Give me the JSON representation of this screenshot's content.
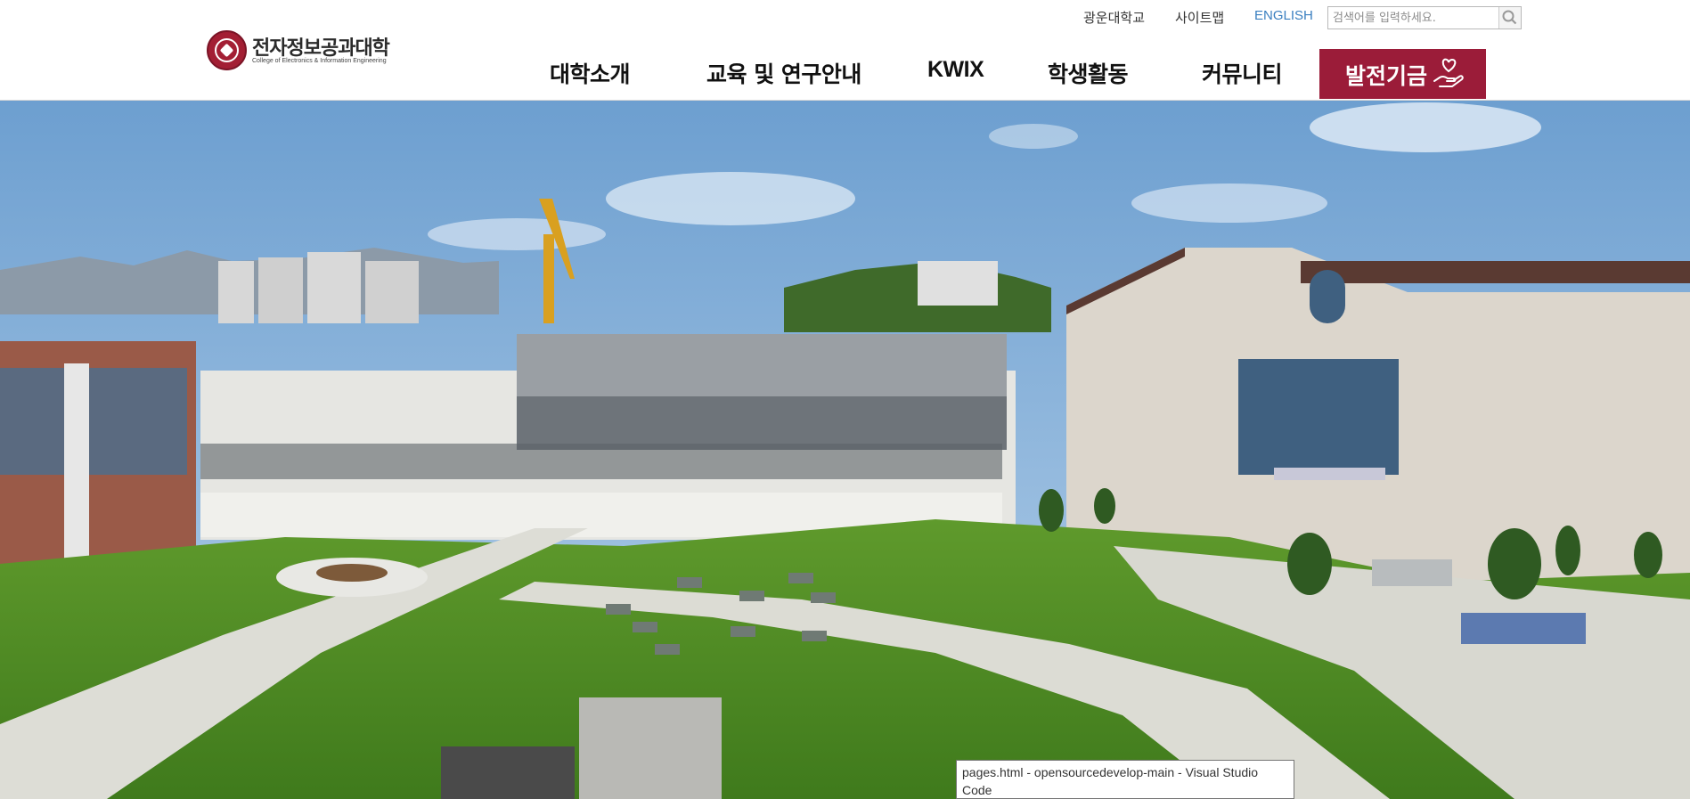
{
  "utility": {
    "university_link": "광운대학교",
    "sitemap_link": "사이트맵",
    "english_link": "ENGLISH",
    "search_placeholder": "검색어를 입력하세요."
  },
  "logo": {
    "name_ko": "전자정보공과대학",
    "name_en": "College of Electronics & Information Engineering"
  },
  "nav": {
    "items": [
      "대학소개",
      "교육 및 연구안내",
      "KWIX",
      "학생활동",
      "커뮤니티"
    ],
    "fund_label": "발전기금"
  },
  "colors": {
    "brand": "#9b1c39",
    "english_link": "#3a7fc0"
  },
  "tooltip": {
    "text": "pages.html - opensourcedevelop-main - Visual Studio Code"
  }
}
